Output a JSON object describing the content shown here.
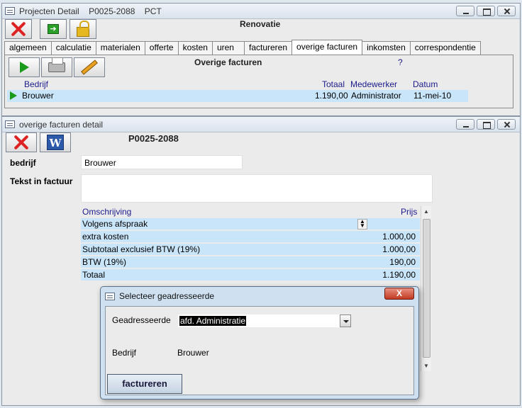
{
  "main_window": {
    "title_parts": [
      "Projecten Detail",
      "P0025-2088",
      "PCT"
    ],
    "heading": "Renovatie",
    "tabs": [
      "algemeen",
      "calculatie",
      "materialen",
      "offerte",
      "kosten",
      "uren",
      "factureren",
      "overige facturen",
      "inkomsten",
      "correspondentie"
    ],
    "active_tab": "overige facturen",
    "section_title": "Overige facturen",
    "help": "?",
    "columns": {
      "bedrijf": "Bedrijf",
      "totaal": "Totaal",
      "medewerker": "Medewerker",
      "datum": "Datum"
    },
    "row": {
      "bedrijf": "Brouwer",
      "totaal": "1.190,00",
      "medewerker": "Administrator",
      "datum": "11-mei-10"
    }
  },
  "detail_window": {
    "title": "overige facturen detail",
    "project_code": "P0025-2088",
    "bedrijf_label": "bedrijf",
    "bedrijf_value": "Brouwer",
    "tekst_label": "Tekst in factuur",
    "tekst_value": "",
    "grid_headers": {
      "omschrijving": "Omschrijving",
      "prijs": "Prijs"
    },
    "grid_rows": [
      {
        "omschrijving": "Volgens afspraak",
        "prijs": ""
      },
      {
        "omschrijving": "extra kosten",
        "prijs": "1.000,00"
      },
      {
        "omschrijving": "Subtotaal exclusief BTW (19%)",
        "prijs": "1.000,00"
      },
      {
        "omschrijving": "BTW (19%)",
        "prijs": "190,00"
      },
      {
        "omschrijving": "Totaal",
        "prijs": "1.190,00"
      }
    ]
  },
  "dialog": {
    "title": "Selecteer geadresseerde",
    "close_label": "X",
    "geadresseerde_label": "Geadresseerde",
    "geadresseerde_value": "afd. Administratie",
    "bedrijf_label": "Bedrijf",
    "bedrijf_value": "Brouwer",
    "submit_label": "factureren"
  }
}
